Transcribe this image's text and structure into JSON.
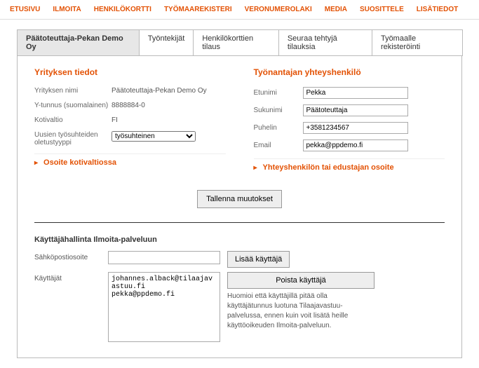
{
  "topnav": [
    "ETUSIVU",
    "ILMOITA",
    "HENKILÖKORTTI",
    "TYÖMAAREKISTERI",
    "VERONUMEROLAKI",
    "MEDIA",
    "SUOSITTELE",
    "LISÄTIEDOT"
  ],
  "tabs": [
    "Päätoteuttaja-Pekan Demo Oy",
    "Työntekijät",
    "Henkilökorttien tilaus",
    "Seuraa tehtyjä tilauksia",
    "Työmaalle rekisteröinti"
  ],
  "company": {
    "sectionTitle": "Yrityksen tiedot",
    "labels": {
      "name": "Yrityksen nimi",
      "ytunnus": "Y-tunnus (suomalainen)",
      "country": "Kotivaltio",
      "reltype": "Uusien työsuhteiden oletustyyppi"
    },
    "values": {
      "name": "Päätoteuttaja-Pekan Demo Oy",
      "ytunnus": "8888884-0",
      "country": "FI",
      "reltype": "työsuhteinen"
    },
    "expander": "Osoite kotivaltiossa"
  },
  "contact": {
    "sectionTitle": "Työnantajan yhteyshenkilö",
    "labels": {
      "first": "Etunimi",
      "last": "Sukunimi",
      "phone": "Puhelin",
      "email": "Email"
    },
    "values": {
      "first": "Pekka",
      "last": "Päätoteuttaja",
      "phone": "+3581234567",
      "email": "pekka@ppdemo.fi"
    },
    "expander": "Yhteyshenkilön tai edustajan osoite"
  },
  "saveBtn": "Tallenna muutokset",
  "mgmt": {
    "title": "Käyttäjähallinta Ilmoita-palveluun",
    "emailLabel": "Sähköpostiosoite",
    "usersLabel": "Käyttäjät",
    "addBtn": "Lisää käyttäjä",
    "removeBtn": "Poista käyttäjä",
    "users": "johannes.alback@tilaajavastuu.fi\npekka@ppdemo.fi",
    "hint": "Huomioi että käyttäjillä pitää olla käyttäjätunnus luotuna Tilaajavastuu-palvelussa, ennen kuin voit lisätä heille käyttöoikeuden Ilmoita-palveluun."
  }
}
